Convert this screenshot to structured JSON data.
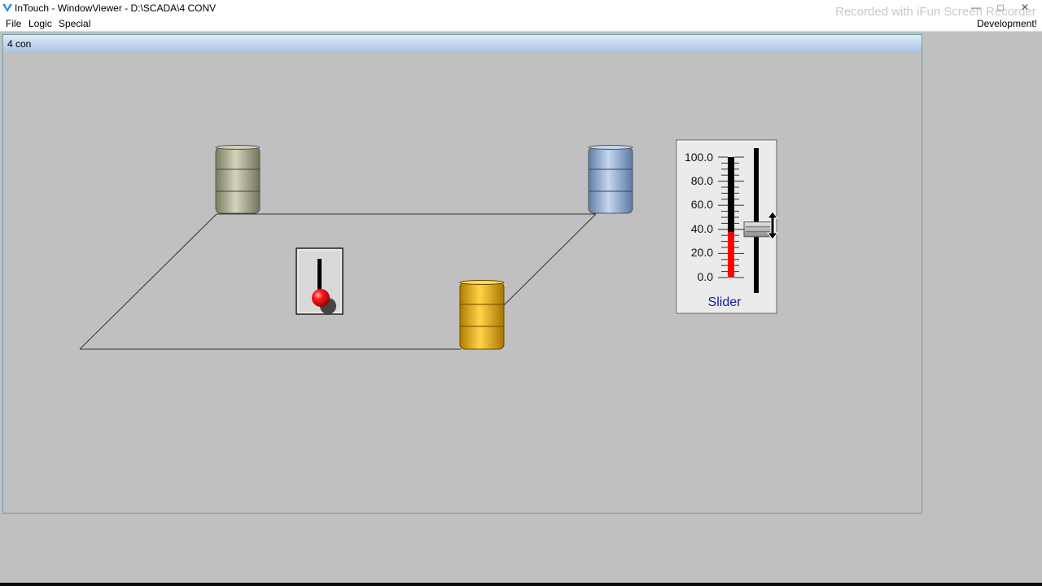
{
  "app": {
    "title": "InTouch - WindowViewer - D:\\SCADA\\4 CONV",
    "watermark": "Recorded with iFun Screen Recorder"
  },
  "menu": {
    "items": [
      "File",
      "Logic",
      "Special"
    ],
    "right_label": "Development!"
  },
  "window": {
    "title": "4 con"
  },
  "slider": {
    "label": "Slider",
    "scale": [
      "100.0",
      "80.0",
      "60.0",
      "40.0",
      "20.0",
      "0.0"
    ],
    "value": 38,
    "max": 100
  },
  "tanks": [
    {
      "name": "olive-tank",
      "color": "#a8a88a"
    },
    {
      "name": "blue-tank",
      "color": "#8eaad0"
    },
    {
      "name": "gold-tank",
      "color": "#e4ac18"
    }
  ],
  "switch": {
    "state": "off",
    "knob_color": "#e80000"
  },
  "colors": {
    "fill_bar": "#ff0000",
    "slider_label": "#0a1aa8"
  }
}
